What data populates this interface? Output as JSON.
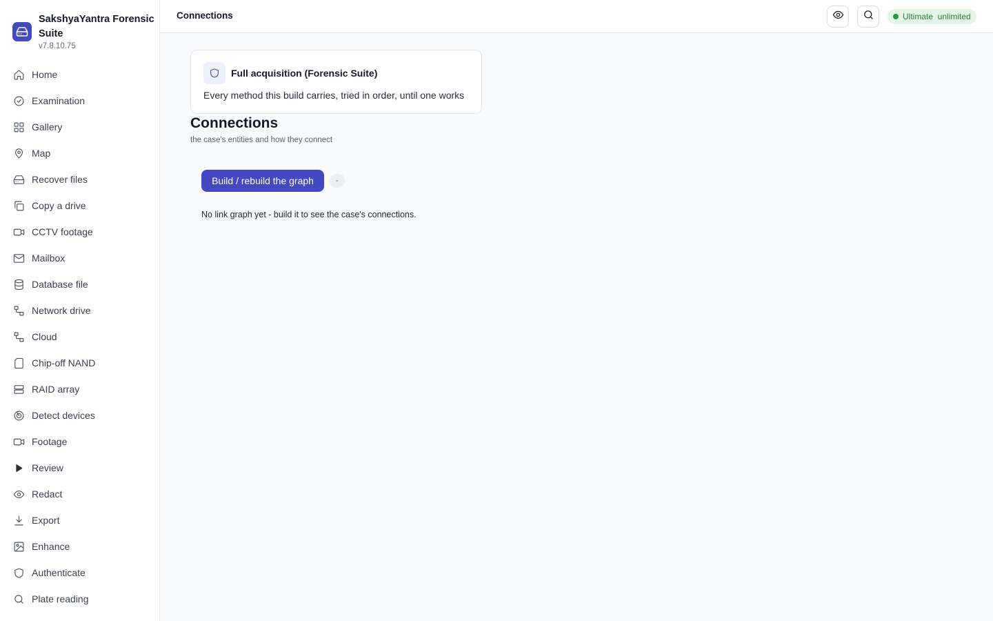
{
  "app": {
    "name": "SakshyaYantra Forensic Suite",
    "version": "v7.8.10.75"
  },
  "sidebar": {
    "items": [
      {
        "label": "Home",
        "icon": "home-icon"
      },
      {
        "label": "Examination",
        "icon": "check-circle-icon"
      },
      {
        "label": "Gallery",
        "icon": "grid-icon"
      },
      {
        "label": "Map",
        "icon": "map-pin-icon"
      },
      {
        "label": "Recover files",
        "icon": "hard-drive-icon"
      },
      {
        "label": "Copy a drive",
        "icon": "copy-icon"
      },
      {
        "label": "CCTV footage",
        "icon": "video-camera-icon"
      },
      {
        "label": "Mailbox",
        "icon": "mail-icon"
      },
      {
        "label": "Database file",
        "icon": "database-icon"
      },
      {
        "label": "Network drive",
        "icon": "network-icon"
      },
      {
        "label": "Cloud",
        "icon": "network-icon"
      },
      {
        "label": "Chip-off NAND",
        "icon": "chip-card-icon"
      },
      {
        "label": "RAID array",
        "icon": "server-icon"
      },
      {
        "label": "Detect devices",
        "icon": "radar-icon"
      },
      {
        "label": "Footage",
        "icon": "video-camera-icon"
      },
      {
        "label": "Review",
        "icon": "play-icon"
      },
      {
        "label": "Redact",
        "icon": "eye-icon"
      },
      {
        "label": "Export",
        "icon": "download-icon"
      },
      {
        "label": "Enhance",
        "icon": "image-icon"
      },
      {
        "label": "Authenticate",
        "icon": "shield-icon"
      },
      {
        "label": "Plate reading",
        "icon": "search-icon"
      }
    ]
  },
  "header": {
    "title": "Connections",
    "license_label": "Ultimate  unlimited"
  },
  "mode_card": {
    "title": "Full acquisition (Forensic Suite)",
    "description": "Every method this build carries, tried in order, until one works"
  },
  "page": {
    "title": "Connections",
    "subtitle": "the case's entities and how they connect",
    "build_button_label": "Build / rebuild the graph",
    "status_chip": "-",
    "empty_message": "No link graph yet - build it to see the case's connections."
  },
  "colors": {
    "accent": "#4349c2",
    "license_bg": "#e3f6e6",
    "license_text": "#2f7d3f",
    "license_dot": "#1f9d3a"
  }
}
